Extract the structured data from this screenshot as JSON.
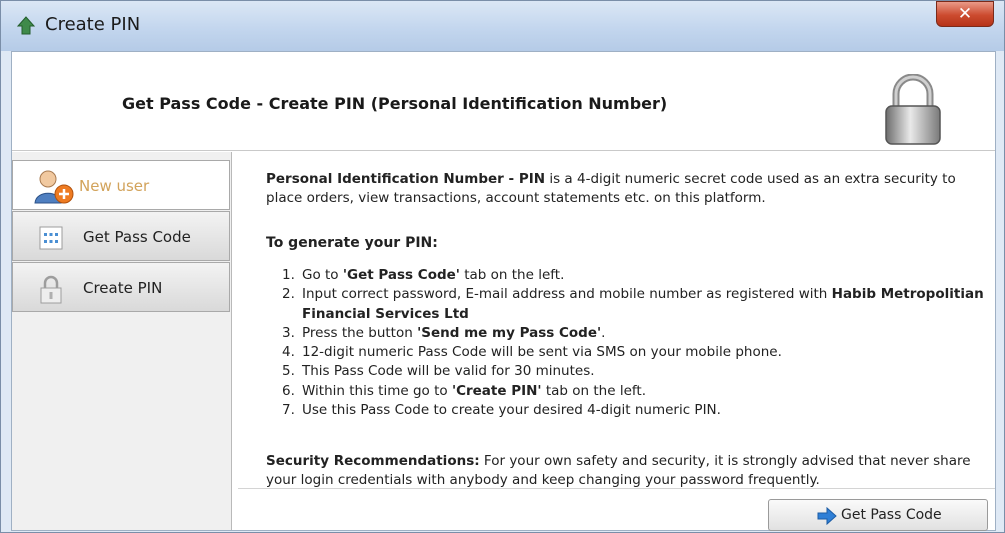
{
  "window": {
    "title": "Create PIN",
    "close_glyph": "✕"
  },
  "header": {
    "title": "Get Pass Code - Create PIN (Personal Identification Number)",
    "icon": "lock-icon"
  },
  "sidebar": {
    "items": [
      {
        "label": "New user",
        "icon": "new-user-icon",
        "active": true
      },
      {
        "label": "Get Pass Code",
        "icon": "pass-code-icon",
        "active": false
      },
      {
        "label": "Create PIN",
        "icon": "create-pin-icon",
        "active": false
      }
    ]
  },
  "content": {
    "intro_bold": "Personal Identification Number - PIN",
    "intro_rest": " is a 4-digit numeric secret code used as an extra security to place orders, view transactions, account statements etc. on this platform.",
    "generate_heading": "To generate your PIN:",
    "steps": [
      {
        "num": "1.",
        "pre": "Go to ",
        "bold": "'Get Pass Code'",
        "post": " tab on the left."
      },
      {
        "num": "2.",
        "pre": "Input correct password, E-mail address and mobile number as registered with ",
        "bold": "Habib Metropolitian Financial Services Ltd",
        "post": ""
      },
      {
        "num": "3.",
        "pre": "Press the button ",
        "bold": "'Send me my Pass Code'",
        "post": "."
      },
      {
        "num": "4.",
        "pre": "12-digit numeric Pass Code will be sent via SMS on your mobile phone.",
        "bold": "",
        "post": ""
      },
      {
        "num": "5.",
        "pre": "This Pass Code will be valid for 30 minutes.",
        "bold": "",
        "post": ""
      },
      {
        "num": "6.",
        "pre": "Within this time go to ",
        "bold": "'Create PIN'",
        "post": " tab on the left."
      },
      {
        "num": "7.",
        "pre": "Use this Pass Code to create your desired 4-digit numeric PIN.",
        "bold": "",
        "post": ""
      }
    ],
    "security_bold": "Security Recommendations:",
    "security_rest": " For your own safety and security, it is strongly advised that never share your login credentials with anybody and keep changing your password frequently."
  },
  "footer": {
    "button_label": "Get Pass Code",
    "button_icon": "arrow-right-icon"
  },
  "colors": {
    "titlebar": "#c3d6ee",
    "close": "#cc4b2f",
    "active_label": "#d2a35b",
    "arrow": "#2f7fd6"
  }
}
